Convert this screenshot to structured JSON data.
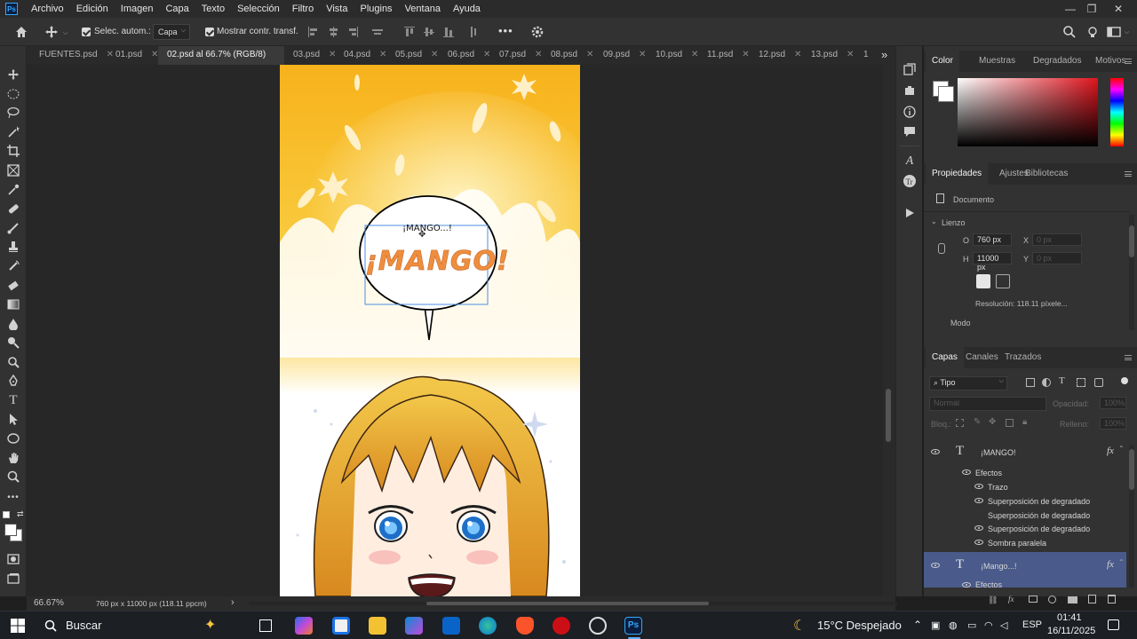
{
  "app": {
    "logo_text": "Ps",
    "menu": [
      "Archivo",
      "Edición",
      "Imagen",
      "Capa",
      "Texto",
      "Selección",
      "Filtro",
      "Vista",
      "Plugins",
      "Ventana",
      "Ayuda"
    ],
    "window_controls": [
      "minimize",
      "restore",
      "close"
    ]
  },
  "options_bar": {
    "auto_select_label": "Selec. autom.:",
    "auto_select_checked": true,
    "layer_select_value": "Capa",
    "show_transform_label": "Mostrar contr. transf.",
    "show_transform_checked": true,
    "more_label": "•••"
  },
  "tabs": [
    {
      "label": "FUENTES.psd",
      "active": false
    },
    {
      "label": "01.psd",
      "active": false
    },
    {
      "label": "02.psd al 66.7% (RGB/8) *",
      "active": true
    },
    {
      "label": "03.psd",
      "active": false
    },
    {
      "label": "04.psd",
      "active": false
    },
    {
      "label": "05.psd",
      "active": false
    },
    {
      "label": "06.psd",
      "active": false
    },
    {
      "label": "07.psd",
      "active": false
    },
    {
      "label": "08.psd",
      "active": false
    },
    {
      "label": "09.psd",
      "active": false
    },
    {
      "label": "10.psd",
      "active": false
    },
    {
      "label": "11.psd",
      "active": false
    },
    {
      "label": "12.psd",
      "active": false
    },
    {
      "label": "13.psd",
      "active": false
    },
    {
      "label": "1",
      "active": false
    }
  ],
  "tabs_overflow": "»",
  "canvas": {
    "bubble_small_text": "¡MANGO...!",
    "bubble_big_text": "¡MANGO!"
  },
  "status": {
    "zoom": "66.67%",
    "doc_size": "760 px x 11000 px (118.11 ppcm)",
    "arrow": "›"
  },
  "color_panel": {
    "tabs": [
      "Color",
      "Muestras",
      "Degradados",
      "Motivos"
    ],
    "active_tab": "Color"
  },
  "properties_panel": {
    "tabs": [
      "Propiedades",
      "Ajustes",
      "Bibliotecas"
    ],
    "document_label": "Documento",
    "section_label": "Lienzo",
    "w_label": "O",
    "w_value": "760 px",
    "h_label": "H",
    "h_value": "11000 px",
    "x_label": "X",
    "x_value": "0 px",
    "y_label": "Y",
    "y_value": "0 px",
    "resolution": "Resolución: 118.11 píxele...",
    "mode_label": "Modo"
  },
  "layers_panel": {
    "tabs": [
      "Capas",
      "Canales",
      "Trazados"
    ],
    "filter_label": "Tipo",
    "blend_mode": "Normal",
    "opacity_label": "Opacidad:",
    "opacity_value": "100%",
    "lock_label": "Bloq.:",
    "fill_label": "Relleno:",
    "fill_value": "100%",
    "layers": [
      {
        "name": "¡MANGO!",
        "type": "text",
        "fx": "fx",
        "selected": false
      },
      {
        "name": "¡Mango...!",
        "type": "text",
        "fx": "fx",
        "selected": true
      }
    ],
    "effects_label": "Efectos",
    "effects": [
      {
        "name": "Trazo",
        "visible": true
      },
      {
        "name": "Superposición de degradado",
        "visible": true
      },
      {
        "name": "Superposición de degradado",
        "visible": false
      },
      {
        "name": "Superposición de degradado",
        "visible": true
      },
      {
        "name": "Sombra paralela",
        "visible": true
      }
    ],
    "effects_label_2": "Efectos"
  },
  "taskbar": {
    "search_label": "Buscar",
    "weather": "15°C Despejado",
    "language": "ESP",
    "time": "01:41",
    "date": "16/11/2025"
  },
  "colors": {
    "accent": "#31a8ff",
    "selection_row": "#4a5a8a"
  }
}
